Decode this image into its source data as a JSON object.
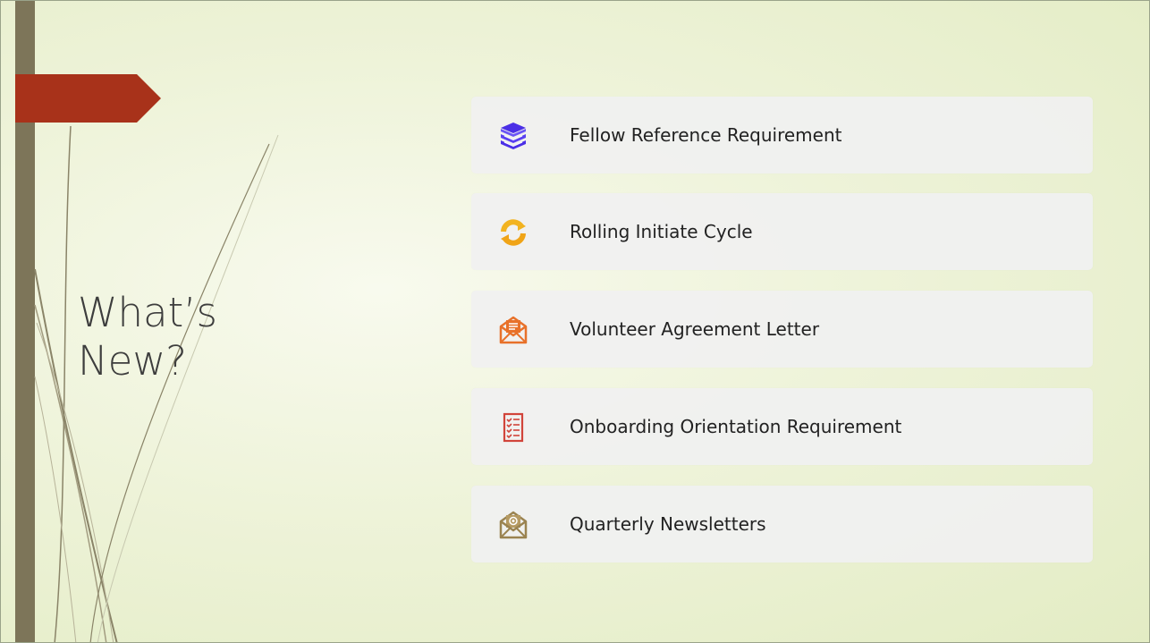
{
  "slide": {
    "title_line1": "What’s",
    "title_line2": "New?"
  },
  "items": [
    {
      "label": "Fellow Reference Requirement",
      "icon": "stacked-books-icon",
      "color": "#4b2fe6"
    },
    {
      "label": "Rolling Initiate Cycle",
      "icon": "refresh-cycle-icon",
      "color": "#f2b320"
    },
    {
      "label": "Volunteer Agreement Letter",
      "icon": "open-envelope-letter-icon",
      "color": "#e8712a"
    },
    {
      "label": "Onboarding Orientation Requirement",
      "icon": "checklist-icon",
      "color": "#d1443a"
    },
    {
      "label": "Quarterly Newsletters",
      "icon": "email-newsletter-icon",
      "color": "#9a8350"
    }
  ],
  "colors": {
    "arrow_tab": "#a8321a",
    "left_bar": "#7d7559",
    "background": "#eef3d9"
  }
}
